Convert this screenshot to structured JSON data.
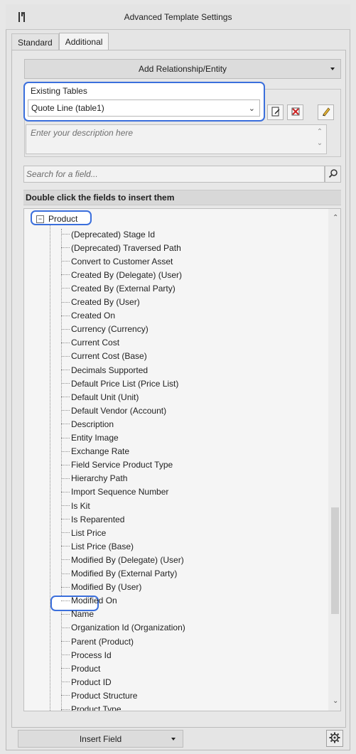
{
  "window": {
    "title": "Advanced Template Settings"
  },
  "tabs": [
    {
      "label": "Standard",
      "active": false
    },
    {
      "label": "Additional",
      "active": true
    }
  ],
  "add_relationship": {
    "label": "Add Relationship/Entity"
  },
  "existing_tables": {
    "label": "Existing Tables",
    "selected": "Quote Line (table1)"
  },
  "description": {
    "placeholder": "Enter your description here"
  },
  "search": {
    "placeholder": "Search for a field..."
  },
  "fields_header": "Double click the fields to insert them",
  "tree": {
    "root": "Product",
    "items": [
      "(Deprecated) Stage Id",
      "(Deprecated) Traversed Path",
      "Convert to Customer Asset",
      "Created By (Delegate) (User)",
      "Created By (External Party)",
      "Created By (User)",
      "Created On",
      "Currency (Currency)",
      "Current Cost",
      "Current Cost (Base)",
      "Decimals Supported",
      "Default Price List (Price List)",
      "Default Unit (Unit)",
      "Default Vendor (Account)",
      "Description",
      "Entity Image",
      "Exchange Rate",
      "Field Service Product Type",
      "Hierarchy Path",
      "Import Sequence Number",
      "Is Kit",
      "Is Reparented",
      "List Price",
      "List Price (Base)",
      "Modified By (Delegate) (User)",
      "Modified By (External Party)",
      "Modified By (User)",
      "Modified On",
      "Name",
      "Organization Id (Organization)",
      "Parent (Product)",
      "Process Id",
      "Product",
      "Product ID",
      "Product Structure",
      "Product Type"
    ]
  },
  "bottom": {
    "insert_field_label": "Insert Field"
  },
  "colors": {
    "highlight": "#3b6fdc"
  }
}
